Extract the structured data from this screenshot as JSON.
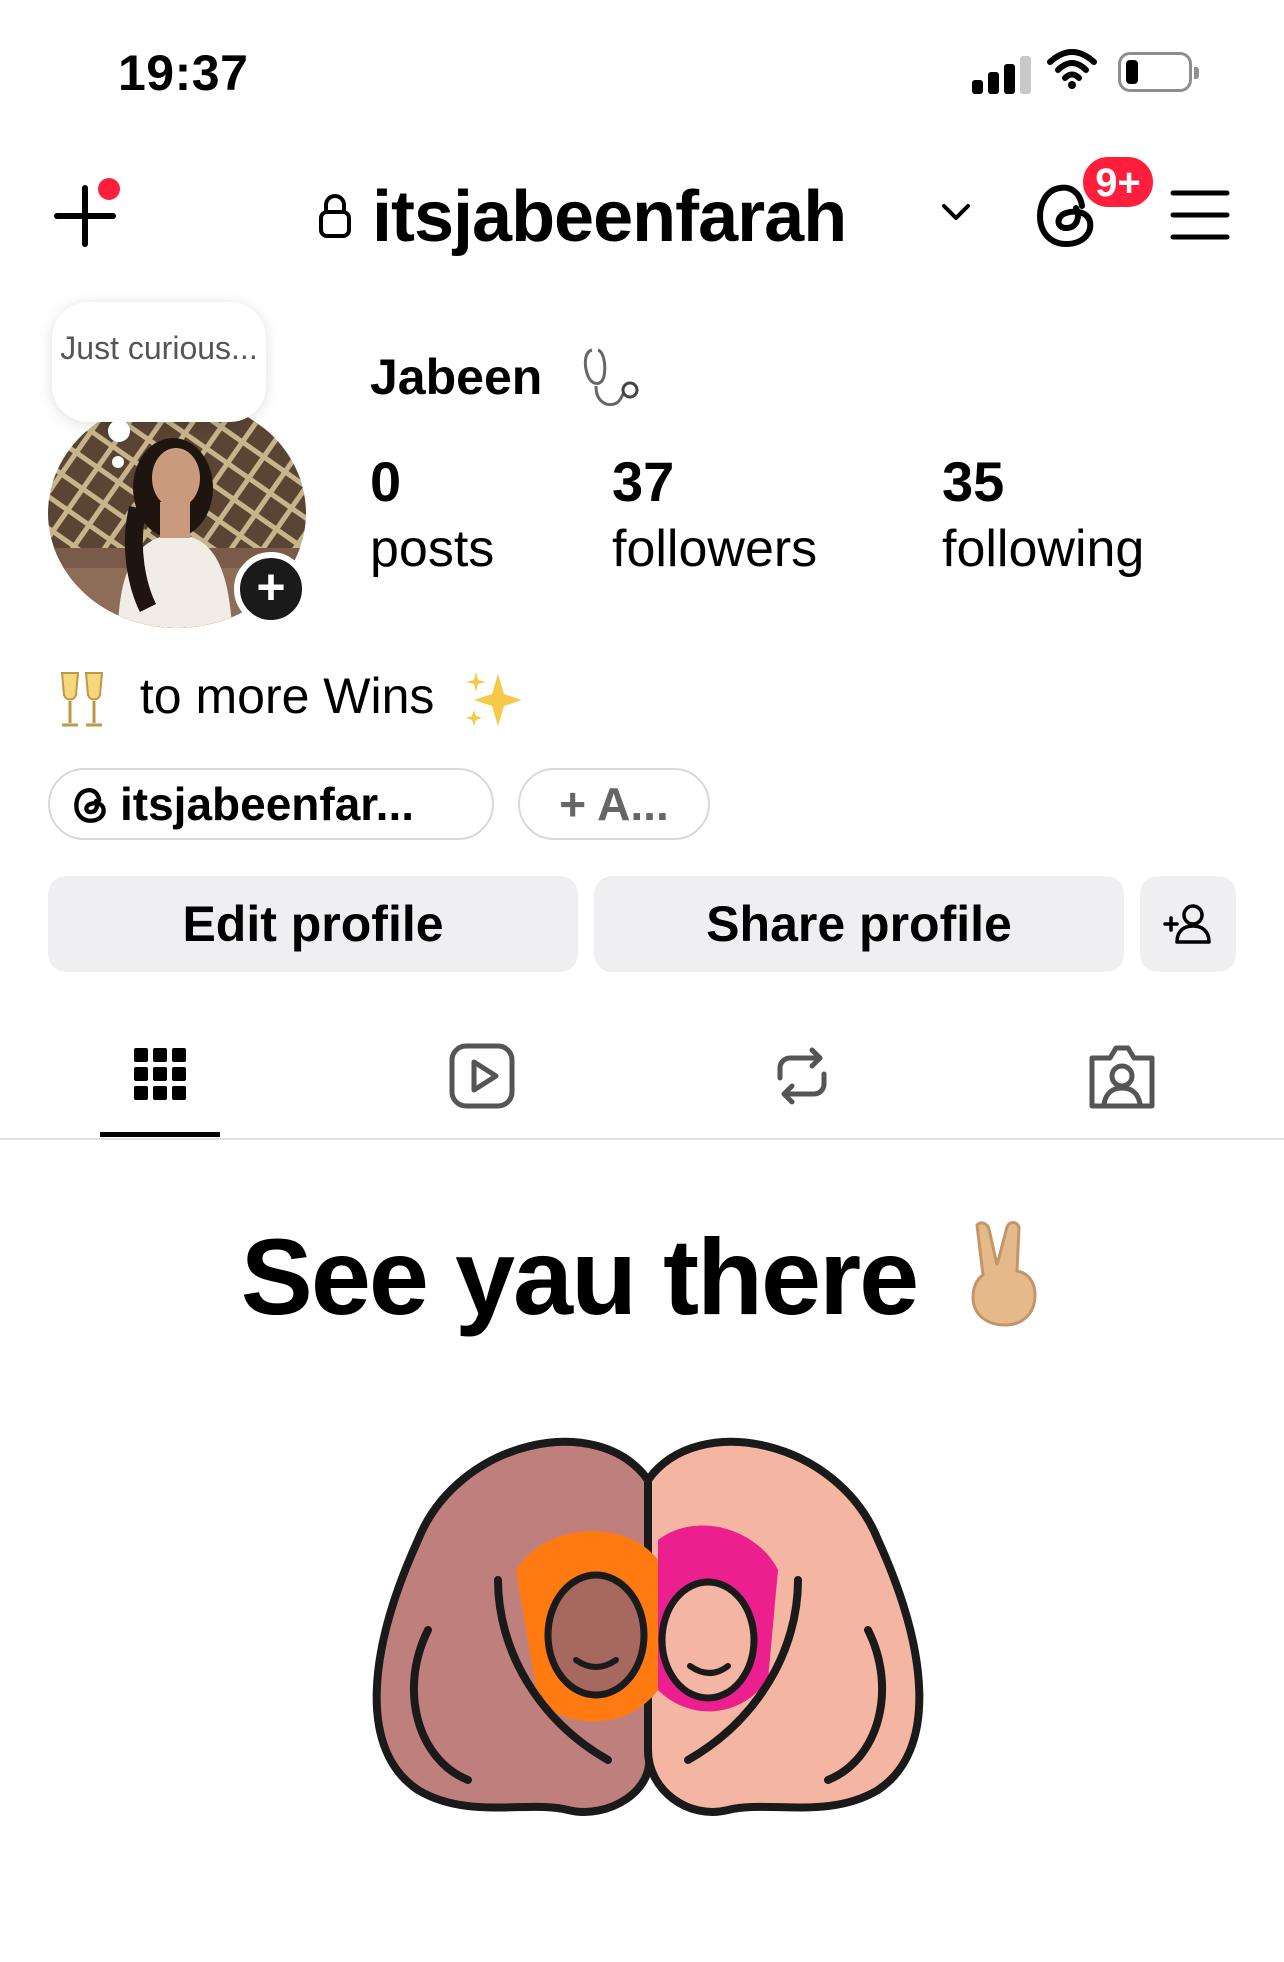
{
  "status_bar": {
    "time": "19:37",
    "battery_level": 0.2
  },
  "header": {
    "username": "itsjabeenfarah",
    "notification_badge": "9+",
    "icons": [
      "plus-icon",
      "lock-icon",
      "chevron-down-icon",
      "threads-icon",
      "hamburger-menu-icon"
    ]
  },
  "profile": {
    "note": "Just curious...",
    "display_name": "Jabeen",
    "stats": [
      {
        "value": "0",
        "label": "posts"
      },
      {
        "value": "37",
        "label": "followers"
      },
      {
        "value": "35",
        "label": "following"
      }
    ],
    "bio": "to more Wins",
    "chips": {
      "threads": "itsjabeenfar...",
      "add": "+ A..."
    }
  },
  "actions": {
    "edit": "Edit profile",
    "share": "Share profile"
  },
  "tabs": [
    "grid-icon",
    "reels-icon",
    "reposts-icon",
    "tagged-icon"
  ],
  "promo": {
    "text": "See yau there"
  },
  "colors": {
    "accent_red": "#ff1f3d",
    "button_bg": "#efeff2"
  }
}
